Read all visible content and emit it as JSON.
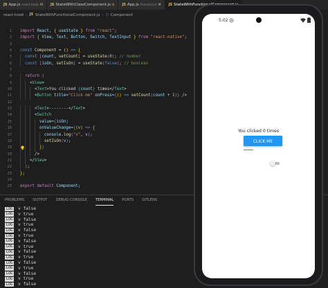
{
  "editor": {
    "tabs": [
      {
        "ext": "JS",
        "name": "App.js",
        "sub": "react-hook",
        "flag": "M"
      },
      {
        "ext": "JS",
        "name": "StateWithClassComponent.js",
        "sub": "",
        "flag": "U"
      },
      {
        "ext": "JS",
        "name": "App.js",
        "sub": "friendsList",
        "flag": "M"
      },
      {
        "ext": "JS",
        "name": "StateWithFunctionalComponent.js",
        "sub": "",
        "flag": ""
      }
    ],
    "breadcrumb": {
      "folder": "react-hook",
      "file_ext": "JS",
      "file": "StateWithFunctionalComponent.js",
      "symbol": "Component"
    },
    "line_numbers": [
      "1",
      "2",
      "3",
      "4",
      "5",
      "6",
      "7",
      "8",
      "9",
      "10",
      "11",
      "12",
      "13",
      "14",
      "15",
      "16",
      "17",
      "18",
      "19",
      "20",
      "21",
      "22",
      "23",
      "24",
      "25"
    ]
  },
  "panel": {
    "tabs": [
      "PROBLEMS",
      "OUTPUT",
      "DEBUG CONSOLE",
      "TERMINAL",
      "PORTS",
      "GITLENS"
    ],
    "active_tab": "TERMINAL",
    "log_tag": "LOG",
    "logs": [
      "v false",
      "v true",
      "v false",
      "v true",
      "v false",
      "v true",
      "v false",
      "v true",
      "v false",
      "v true",
      "v false",
      "v true",
      "v false",
      "v true",
      "v false"
    ]
  },
  "phone": {
    "status_time": "5:02",
    "count_text": "You clicked 0 times",
    "button_label": "CLICK ME",
    "switch_on": false
  },
  "colors": {
    "editor_bg": "#1e1e1e",
    "button_blue": "#2196f3",
    "keyword": "#569cd6",
    "string": "#ce9178",
    "comment": "#6a9955"
  }
}
